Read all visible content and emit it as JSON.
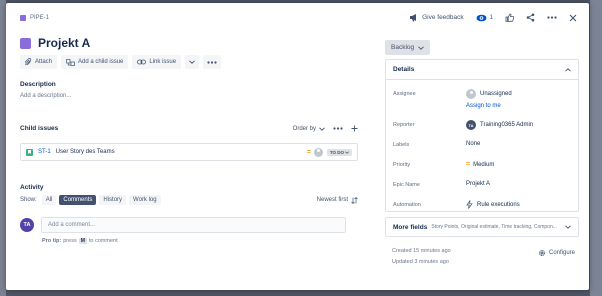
{
  "colors": {
    "accent": "#0052cc",
    "epic_purple": "#8a6cdb",
    "story_green": "#36b37e",
    "priority_medium": "#ff991f",
    "avatar_purple": "#5243aa"
  },
  "header": {
    "issue_key": "PIPE-1",
    "give_feedback": "Give feedback",
    "watchers_count": "1",
    "icons": [
      "megaphone-icon",
      "eye-icon",
      "thumbs-up-icon",
      "share-icon",
      "more-icon",
      "close-icon"
    ]
  },
  "title": "Projekt A",
  "toolbar": {
    "attach": "Attach",
    "add_child": "Add a child issue",
    "link_issue": "Link issue"
  },
  "description": {
    "label": "Description",
    "placeholder": "Add a description..."
  },
  "child_issues": {
    "label": "Child issues",
    "order_by": "Order by",
    "items": [
      {
        "key": "ST-1",
        "summary": "User Story des Teams",
        "status": "TO DO"
      }
    ]
  },
  "activity": {
    "label": "Activity",
    "show_label": "Show:",
    "tabs": [
      "All",
      "Comments",
      "History",
      "Work log"
    ],
    "active_tab": "Comments",
    "sort": "Newest first",
    "avatar_initials": "TA",
    "comment_placeholder": "Add a comment...",
    "protip_prefix": "Pro tip:",
    "protip_press": "press",
    "protip_key": "M",
    "protip_suffix": "to comment"
  },
  "status_button": "Backlog",
  "details": {
    "heading": "Details",
    "assignee_label": "Assignee",
    "assignee_value": "Unassigned",
    "assign_to_me": "Assign to me",
    "reporter_label": "Reporter",
    "reporter_initials": "TA",
    "reporter_value": "Training0365 Admin",
    "labels_label": "Labels",
    "labels_value": "None",
    "priority_label": "Priority",
    "priority_value": "Medium",
    "epic_name_label": "Epic Name",
    "epic_name_value": "Projekt A",
    "automation_label": "Automation",
    "automation_value": "Rule executions"
  },
  "more_fields": {
    "label": "More fields",
    "sub": "Story Points, Original estimate, Time tracking, Compon..."
  },
  "footer": {
    "created": "Created 15 minutes ago",
    "updated": "Updated 3 minutes ago",
    "configure": "Configure"
  }
}
